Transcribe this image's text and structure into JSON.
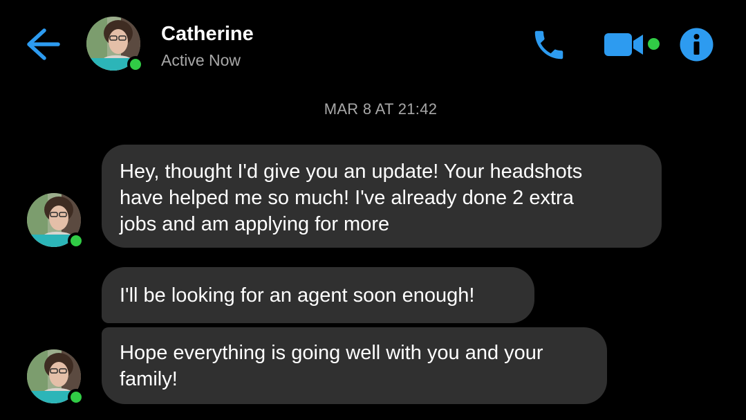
{
  "header": {
    "contact_name": "Catherine",
    "status": "Active Now",
    "back_icon": "arrow-left-icon",
    "call_icon": "phone-icon",
    "video_icon": "video-camera-icon",
    "info_icon": "info-icon",
    "accent_color": "#2d9bf0",
    "presence_color": "#31cc46"
  },
  "conversation": {
    "timestamp": "MAR 8 AT 21:42",
    "messages": [
      {
        "lines": [
          "Hey, thought I'd give you an update! Your headshots",
          "have helped me so much! I've already done 2 extra",
          "jobs and am applying for more"
        ]
      },
      {
        "lines": [
          "I'll be looking for an agent soon enough!"
        ]
      },
      {
        "lines": [
          "Hope everything is going well with you and your",
          "family!"
        ]
      }
    ],
    "bubble_color": "#303030"
  }
}
